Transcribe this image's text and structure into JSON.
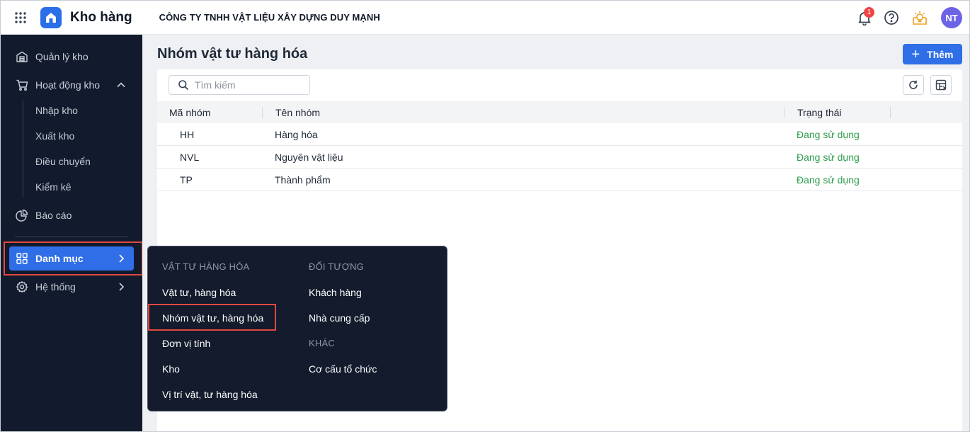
{
  "header": {
    "app_name": "Kho hàng",
    "company": "CÔNG TY TNHH VẬT LIỆU XÂY DỰNG DUY MẠNH",
    "notification_count": "1",
    "avatar_initials": "NT"
  },
  "sidebar": {
    "items": [
      {
        "label": "Quản lý kho",
        "icon": "warehouse-icon"
      },
      {
        "label": "Hoạt động kho",
        "icon": "cart-icon"
      },
      {
        "label": "Báo cáo",
        "icon": "pie-chart-icon"
      },
      {
        "label": "Danh mục",
        "icon": "grid-icon"
      },
      {
        "label": "Hệ thống",
        "icon": "gear-icon"
      }
    ],
    "subitems": [
      "Nhập kho",
      "Xuất kho",
      "Điều chuyển",
      "Kiểm kê"
    ]
  },
  "page": {
    "title": "Nhóm vật tư hàng hóa",
    "add_label": "Thêm",
    "search_placeholder": "Tìm kiếm"
  },
  "table": {
    "columns": [
      "Mã nhóm",
      "Tên nhóm",
      "Trạng thái"
    ],
    "rows": [
      {
        "code": "HH",
        "name": "Hàng hóa",
        "status": "Đang sử dụng"
      },
      {
        "code": "NVL",
        "name": "Nguyên vật liệu",
        "status": "Đang sử dụng"
      },
      {
        "code": "TP",
        "name": "Thành phẩm",
        "status": "Đang sử dụng"
      }
    ]
  },
  "popup": {
    "col1_header": "VẬT TƯ HÀNG HÓA",
    "col1_items": [
      "Vật tư, hàng hóa",
      "Nhóm vật tư, hàng hóa",
      "Đơn vị tính",
      "Kho",
      "Vị trí vật, tư hàng hóa"
    ],
    "col2_header": "ĐỐI TƯỢNG",
    "col2_items": [
      "Khách hàng",
      "Nhà cung cấp"
    ],
    "col3_header": "KHÁC",
    "col3_items": [
      "Cơ cấu tổ chức"
    ]
  },
  "colors": {
    "accent": "#2f6ee6",
    "sidebar_bg": "#121b2d",
    "status_active": "#2e9d4d",
    "highlight_box": "#e0493f"
  }
}
